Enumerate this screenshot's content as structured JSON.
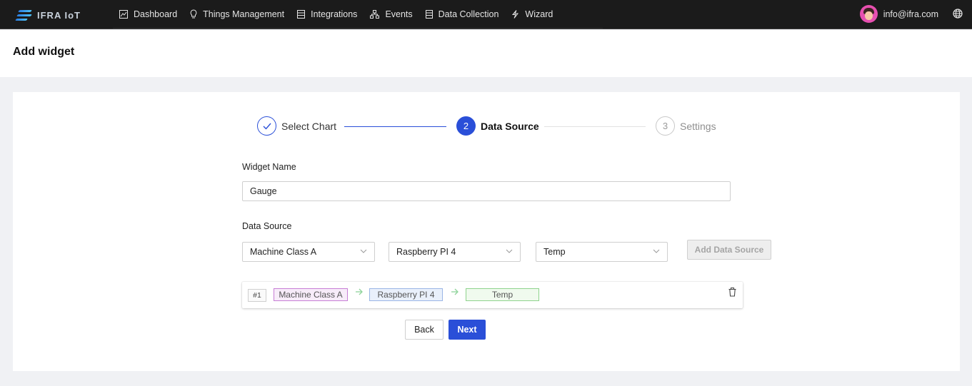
{
  "app": {
    "brand": "IFRA IoT"
  },
  "nav": [
    {
      "label": "Dashboard",
      "icon": "chart-line-icon"
    },
    {
      "label": "Things Management",
      "icon": "lightbulb-icon"
    },
    {
      "label": "Integrations",
      "icon": "server-icon"
    },
    {
      "label": "Events",
      "icon": "sitemap-icon"
    },
    {
      "label": "Data Collection",
      "icon": "database-icon"
    },
    {
      "label": "Wizard",
      "icon": "bolt-icon"
    }
  ],
  "user": {
    "email": "info@ifra.com"
  },
  "page": {
    "title": "Add widget"
  },
  "steps": [
    {
      "number": "",
      "label": "Select Chart",
      "status": "done"
    },
    {
      "number": "2",
      "label": "Data Source",
      "status": "active"
    },
    {
      "number": "3",
      "label": "Settings",
      "status": "pending"
    }
  ],
  "form": {
    "widget_name_label": "Widget Name",
    "widget_name_value": "Gauge",
    "data_source_label": "Data Source",
    "selects": [
      "Machine Class A",
      "Raspberry PI 4",
      "Temp"
    ],
    "add_button": "Add Data Source"
  },
  "source_row": {
    "index": "#1",
    "class_tag": "Machine Class A",
    "device_tag": "Raspberry PI 4",
    "metric_tag": "Temp"
  },
  "buttons": {
    "back": "Back",
    "next": "Next"
  },
  "colors": {
    "accent": "#2a4fd8",
    "topbar": "#1b1b1b"
  }
}
